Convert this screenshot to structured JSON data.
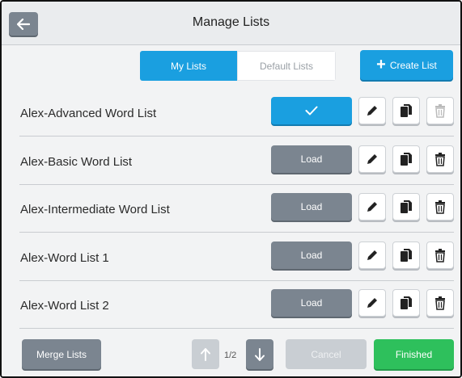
{
  "header": {
    "title": "Manage Lists",
    "back_icon": "back-arrow-icon"
  },
  "tabs": [
    {
      "label": "My Lists",
      "active": true
    },
    {
      "label": "Default Lists",
      "active": false
    }
  ],
  "create_button": {
    "label": "Create List",
    "icon": "plus-icon"
  },
  "lists": [
    {
      "name": "Alex-Advanced Word List",
      "action_label": "",
      "loaded": true
    },
    {
      "name": "Alex-Basic Word List",
      "action_label": "Load",
      "loaded": false
    },
    {
      "name": "Alex-Intermediate Word List",
      "action_label": "Load",
      "loaded": false
    },
    {
      "name": "Alex-Word List 1",
      "action_label": "Load",
      "loaded": false
    },
    {
      "name": "Alex-Word List 2",
      "action_label": "Load",
      "loaded": false
    }
  ],
  "row_icons": [
    "pencil-icon",
    "copy-icon",
    "trash-icon"
  ],
  "footer": {
    "merge_label": "Merge Lists",
    "page_indicator": "1/2",
    "cancel_label": "Cancel",
    "finished_label": "Finished"
  },
  "colors": {
    "accent_blue": "#1a9fe0",
    "button_grey": "#7b8590",
    "finished_green": "#2ec05c",
    "disabled_grey": "#c9ced3"
  }
}
